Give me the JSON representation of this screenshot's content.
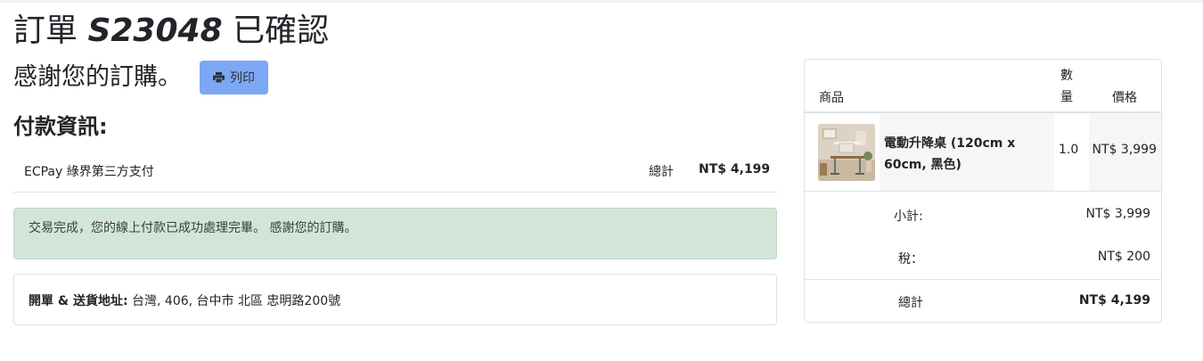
{
  "header": {
    "title_prefix": "訂單 ",
    "order_number": "S23048",
    "title_suffix": " 已確認",
    "thanks": "感謝您的訂購。",
    "print_label": "列印",
    "print_icon": "printer-icon"
  },
  "payment": {
    "heading": "付款資訊:",
    "method": "ECPay 綠界第三方支付",
    "total_label": "總計",
    "total_value": "NT$ 4,199"
  },
  "alert": {
    "message": "交易完成，您的線上付款已成功處理完畢。 感謝您的訂購。",
    "color": "#d2e5d8"
  },
  "address": {
    "label": "開單 & 送貨地址:",
    "value": " 台灣, 406, 台中市 北區 忠明路200號"
  },
  "summary": {
    "col_product": "商品",
    "col_qty": "數量",
    "col_price": "價格",
    "items": [
      {
        "name": "電動升降桌 (120cm x 60cm, 黑色)",
        "qty": "1.0",
        "price": "NT$ 3,999"
      }
    ],
    "subtotal_label": "小計:",
    "subtotal_value": "NT$ 3,999",
    "tax_label": "稅：",
    "tax_value": "NT$ 200",
    "total_label": "總計",
    "total_value": "NT$ 4,199"
  }
}
